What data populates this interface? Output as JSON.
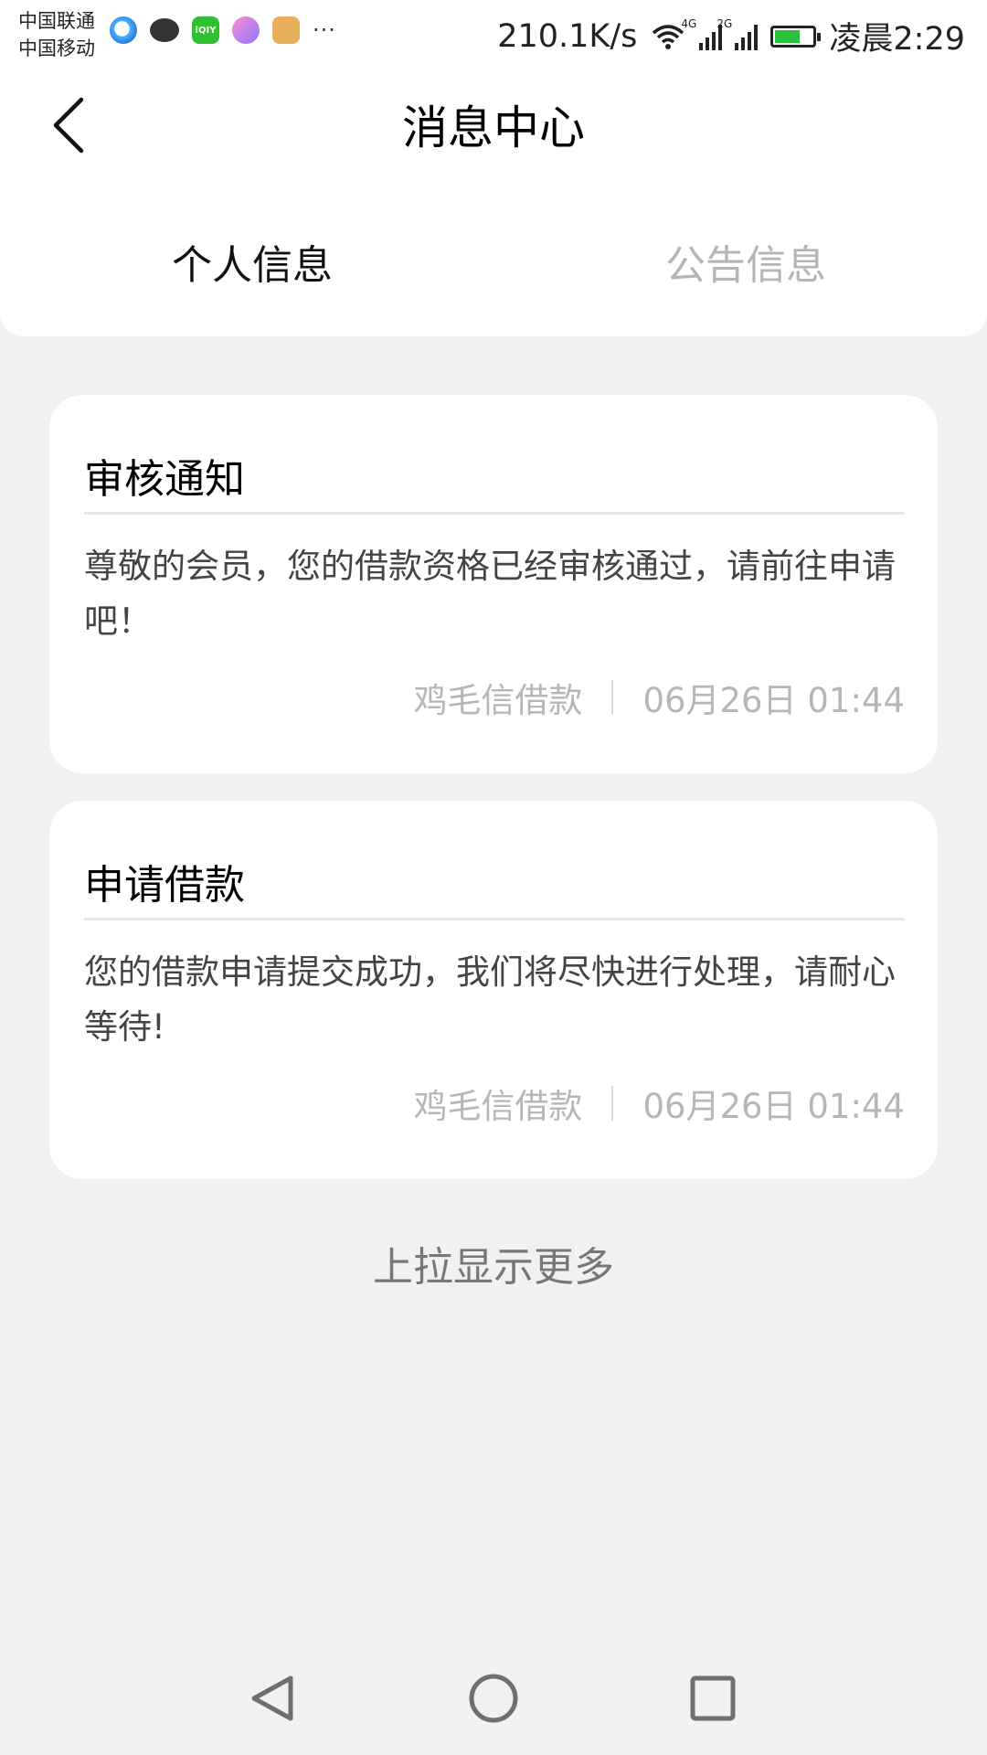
{
  "status_bar": {
    "carrier_1": "中国联通",
    "carrier_2": "中国移动",
    "apps": [
      "browser-icon",
      "chat-bubble-icon",
      "iqiyi-icon",
      "soul-icon",
      "wallet-icon"
    ],
    "iqiyi_label": "iQIY",
    "more": "···",
    "net_speed": "210.1K/s",
    "signal_1_tag": "4G",
    "signal_2_tag": "2G",
    "time": "凌晨2:29",
    "battery_color": "#2bc23d"
  },
  "header": {
    "title": "消息中心"
  },
  "tabs": [
    {
      "label": "个人信息",
      "active": true
    },
    {
      "label": "公告信息",
      "active": false
    }
  ],
  "messages": [
    {
      "title": "审核通知",
      "body": "尊敬的会员，您的借款资格已经审核通过，请前往申请吧！",
      "source": "鸡毛信借款",
      "time": "06月26日 01:44"
    },
    {
      "title": "申请借款",
      "body": "您的借款申请提交成功，我们将尽快进行处理，请耐心等待!",
      "source": "鸡毛信借款",
      "time": "06月26日 01:44"
    }
  ],
  "load_more": "上拉显示更多"
}
